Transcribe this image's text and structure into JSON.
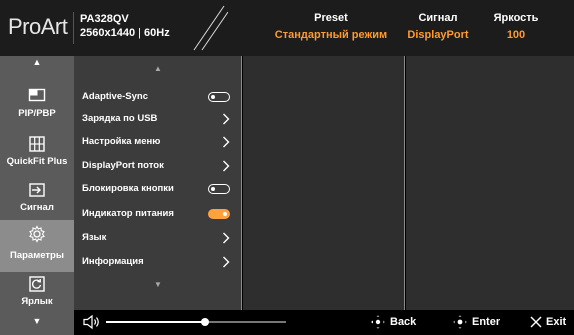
{
  "header": {
    "logo": "ProArt",
    "model": "PA328QV",
    "resolution": "2560x1440",
    "refresh": "60Hz",
    "stats": [
      {
        "label": "Preset",
        "value": "Стандартный режим"
      },
      {
        "label": "Сигнал",
        "value": "DisplayPort"
      },
      {
        "label": "Яркость",
        "value": "100"
      }
    ]
  },
  "sidebar": {
    "items": [
      {
        "label": "PIP/PBP",
        "icon": "pip-icon"
      },
      {
        "label": "QuickFit Plus",
        "icon": "grid-icon"
      },
      {
        "label": "Сигнал",
        "icon": "input-icon"
      },
      {
        "label": "Параметры",
        "icon": "settings-icon"
      },
      {
        "label": "Ярлык",
        "icon": "shortcut-icon"
      }
    ],
    "active_index": 3
  },
  "menu": {
    "items": [
      {
        "label": "Adaptive-Sync",
        "control": "toggle",
        "on": false
      },
      {
        "label": "Зарядка по USB",
        "control": "chevron"
      },
      {
        "label": "Настройка меню",
        "control": "chevron"
      },
      {
        "label": "DisplayPort поток",
        "control": "chevron"
      },
      {
        "label": "Блокировка кнопки",
        "control": "toggle",
        "on": false
      },
      {
        "label": "Индикатор питания",
        "control": "toggle",
        "on": true
      },
      {
        "label": "Язык",
        "control": "chevron"
      },
      {
        "label": "Информация",
        "control": "chevron"
      }
    ]
  },
  "footer": {
    "volume_fraction": 0.55,
    "back_label": "Back",
    "enter_label": "Enter",
    "exit_label": "Exit"
  },
  "colors": {
    "accent": "#ff9a2e",
    "toggle_on": "#ffa13d",
    "sidebar_bg": "#5b5b5b",
    "sidebar_active": "#8c8c8c",
    "menu_bg": "#3c3c3c"
  }
}
